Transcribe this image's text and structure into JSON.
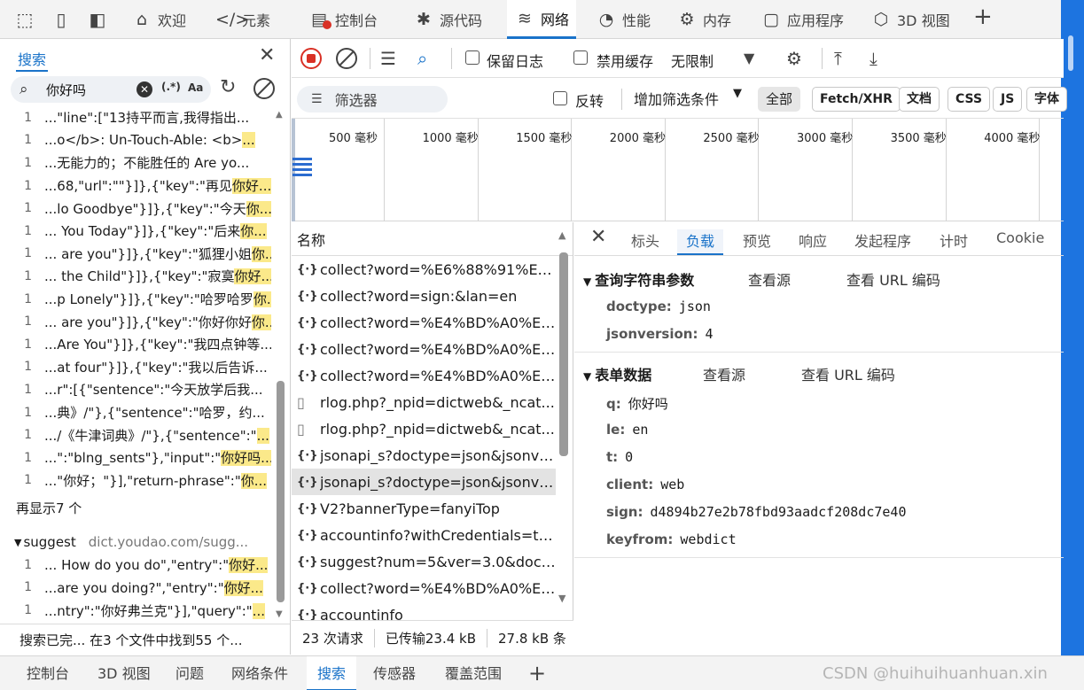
{
  "top_tabs": [
    {
      "icon": "home-icon",
      "label": "欢迎"
    },
    {
      "icon": "code-icon",
      "label": "元素"
    },
    {
      "icon": "console-icon",
      "label": "控制台"
    },
    {
      "icon": "bug-icon",
      "label": "源代码"
    },
    {
      "icon": "wifi-icon",
      "label": "网络"
    },
    {
      "icon": "performance-icon",
      "label": "性能"
    },
    {
      "icon": "memory-icon",
      "label": "内存"
    },
    {
      "icon": "app-icon",
      "label": "应用程序"
    },
    {
      "icon": "cube-icon",
      "label": "3D 视图"
    }
  ],
  "search_panel": {
    "tab": "搜索",
    "query": "你好吗",
    "regex_label": "(.*)",
    "case_label": "Aa",
    "results": [
      {
        "line": "1",
        "pre": "...\"line\":[\"13持平而言,我得指出...",
        "hit": ""
      },
      {
        "line": "1",
        "pre": "...o</b>: Un-Touch-Able: <b>",
        "hit": "..."
      },
      {
        "line": "1",
        "pre": "...无能力的；不能胜任的 Are yo...",
        "hit": ""
      },
      {
        "line": "1",
        "pre": "...68,\"url\":\"\"}]},{\"key\":\"再见",
        "hit": "你好..."
      },
      {
        "line": "1",
        "pre": "...lo Goodbye\"}]},{\"key\":\"今天",
        "hit": "你..."
      },
      {
        "line": "1",
        "pre": "... You Today\"}]},{\"key\":\"后来",
        "hit": "你..."
      },
      {
        "line": "1",
        "pre": "... are you\"}]},{\"key\":\"狐狸小姐",
        "hit": "你..."
      },
      {
        "line": "1",
        "pre": "... the Child\"}]},{\"key\":\"寂寞",
        "hit": "你好..."
      },
      {
        "line": "1",
        "pre": "...p Lonely\"}]},{\"key\":\"哈罗哈罗",
        "hit": "你..."
      },
      {
        "line": "1",
        "pre": "... are you\"}]},{\"key\":\"你好你好",
        "hit": "你..."
      },
      {
        "line": "1",
        "pre": "...Are You\"}]},{\"key\":\"我四点钟等...",
        "hit": ""
      },
      {
        "line": "1",
        "pre": "...at four\"}]},{\"key\":\"我以后告诉...",
        "hit": ""
      },
      {
        "line": "1",
        "pre": "...r\":[{\"sentence\":\"今天放学后我...",
        "hit": ""
      },
      {
        "line": "1",
        "pre": "...典》/\"},{\"sentence\":\"哈罗，约...",
        "hit": ""
      },
      {
        "line": "1",
        "pre": ".../《牛津词典》/\"},{\"sentence\":\"",
        "hit": "..."
      },
      {
        "line": "1",
        "pre": "...\":\"blng_sents\"},\"input\":\"",
        "hit": "你好吗..."
      },
      {
        "line": "1",
        "pre": "...\"你好；\"}],\"return-phrase\":\"",
        "hit": "你..."
      }
    ],
    "more": "再显示7 个",
    "group": {
      "name": "suggest",
      "domain": "dict.youdao.com/sugg..."
    },
    "group_results": [
      {
        "line": "1",
        "pre": "... How do you do\",\"entry\":\"",
        "hit": "你好..."
      },
      {
        "line": "1",
        "pre": "...are you doing?\",\"entry\":\"",
        "hit": "你好..."
      },
      {
        "line": "1",
        "pre": "...ntry\":\"你好弗兰克\"}],\"query\":\"",
        "hit": "..."
      }
    ],
    "status": "搜索已完...   在3 个文件中找到55 个..."
  },
  "toolbar": {
    "preserve_log": "保留日志",
    "disable_cache": "禁用缓存",
    "throttle": "无限制"
  },
  "filter": {
    "placeholder": "筛选器",
    "invert": "反转",
    "more_filters": "增加筛选条件",
    "types": [
      "全部",
      "Fetch/XHR",
      "文档",
      "CSS",
      "JS",
      "字体"
    ]
  },
  "timeline": {
    "ticks": [
      "500 毫秒",
      "1000 毫秒",
      "1500 毫秒",
      "2000 毫秒",
      "2500 毫秒",
      "3000 毫秒",
      "3500 毫秒",
      "4000 毫秒"
    ]
  },
  "requests": {
    "header": "名称",
    "items": [
      {
        "icon": "{·}",
        "name": "collect?word=%E6%88%91%E6..."
      },
      {
        "icon": "{·}",
        "name": "collect?word=sign:&lan=en"
      },
      {
        "icon": "{·}",
        "name": "collect?word=%E4%BD%A0%E5..."
      },
      {
        "icon": "{·}",
        "name": "collect?word=%E4%BD%A0%E5..."
      },
      {
        "icon": "{·}",
        "name": "collect?word=%E4%BD%A0%E5..."
      },
      {
        "icon": "doc",
        "name": "rlog.php?_npid=dictweb&_ncat..."
      },
      {
        "icon": "doc",
        "name": "rlog.php?_npid=dictweb&_ncat..."
      },
      {
        "icon": "{·}",
        "name": "jsonapi_s?doctype=json&jsonve..."
      },
      {
        "icon": "{·}",
        "name": "jsonapi_s?doctype=json&jsonve..."
      },
      {
        "icon": "{·}",
        "name": "V2?bannerType=fanyiTop"
      },
      {
        "icon": "{·}",
        "name": "accountinfo?withCredentials=true"
      },
      {
        "icon": "{·}",
        "name": "suggest?num=5&ver=3.0&doct..."
      },
      {
        "icon": "{·}",
        "name": "collect?word=%E4%BD%A0%E5..."
      },
      {
        "icon": "{·}",
        "name": "accountinfo"
      }
    ]
  },
  "net_status": {
    "requests": "23 次请求",
    "transferred": "已传输23.4 kB",
    "resources": "27.8 kB 条"
  },
  "details": {
    "tabs": [
      "标头",
      "负载",
      "预览",
      "响应",
      "发起程序",
      "计时",
      "Cookie"
    ],
    "query_section": {
      "title": "查询字符串参数",
      "view_source": "查看源",
      "view_url": "查看 URL 编码",
      "params": [
        {
          "k": "doctype:",
          "v": "json"
        },
        {
          "k": "jsonversion:",
          "v": "4"
        }
      ]
    },
    "form_section": {
      "title": "表单数据",
      "view_source": "查看源",
      "view_url": "查看 URL 编码",
      "params": [
        {
          "k": "q:",
          "v": "你好吗"
        },
        {
          "k": "le:",
          "v": "en"
        },
        {
          "k": "t:",
          "v": "0"
        },
        {
          "k": "client:",
          "v": "web"
        },
        {
          "k": "sign:",
          "v": "d4894b27e2b78fbd93aadcf208dc7e40"
        },
        {
          "k": "keyfrom:",
          "v": "webdict"
        }
      ]
    }
  },
  "bottom_tabs": [
    "控制台",
    "3D 视图",
    "问题",
    "网络条件",
    "搜索",
    "传感器",
    "覆盖范围"
  ],
  "watermark": "CSDN @huihuihuanhuan.xin",
  "colors": {
    "accent": "#1a73c9",
    "highlight": "#fbe98a",
    "record": "#d93025",
    "edge": "#1d74e0"
  }
}
